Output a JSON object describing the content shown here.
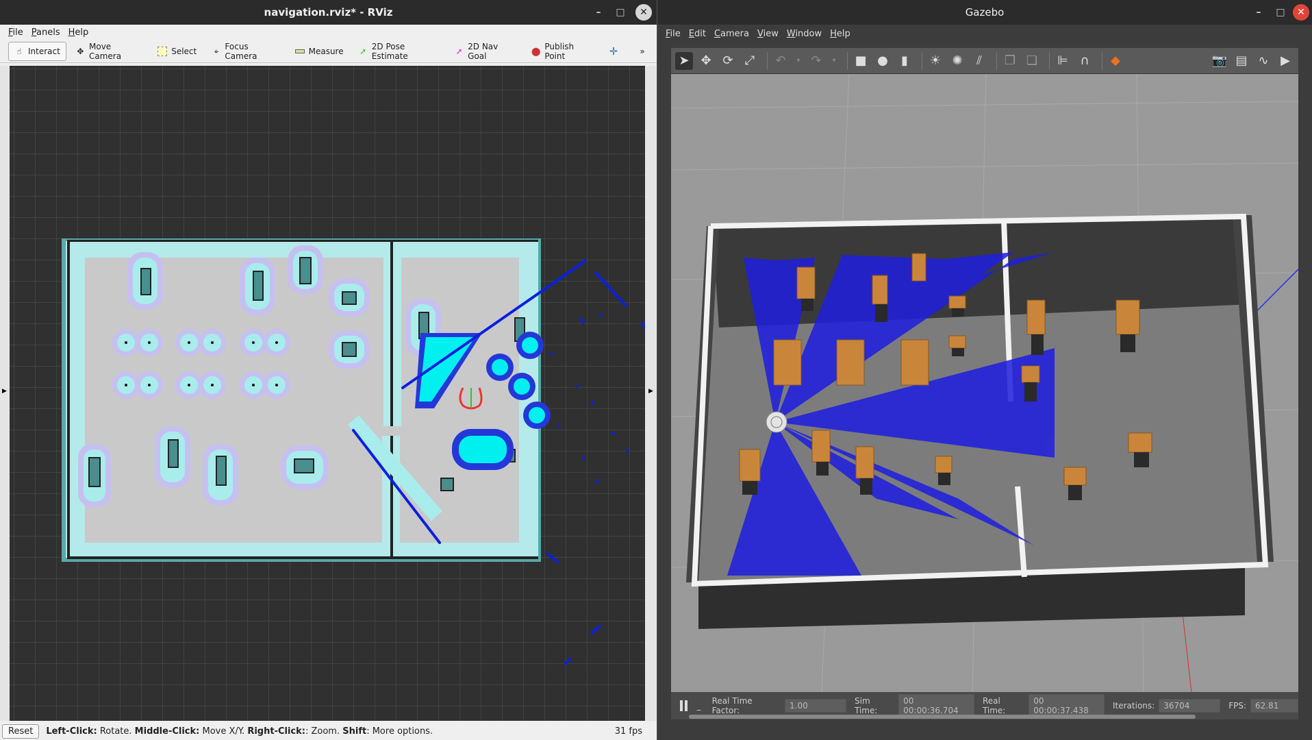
{
  "rviz": {
    "title": "navigation.rviz* - RViz",
    "menu": [
      "File",
      "Panels",
      "Help"
    ],
    "tools": [
      {
        "label": "Interact",
        "icon": "cursor-icon"
      },
      {
        "label": "Move Camera",
        "icon": "move-camera-icon"
      },
      {
        "label": "Select",
        "icon": "select-icon"
      },
      {
        "label": "Focus Camera",
        "icon": "focus-camera-icon"
      },
      {
        "label": "Measure",
        "icon": "measure-icon"
      },
      {
        "label": "2D Pose Estimate",
        "icon": "pose-estimate-icon"
      },
      {
        "label": "2D Nav Goal",
        "icon": "nav-goal-icon"
      },
      {
        "label": "Publish Point",
        "icon": "publish-point-icon"
      }
    ],
    "status": {
      "reset": "Reset",
      "lc": "Left-Click:",
      "lc_t": " Rotate. ",
      "mc": "Middle-Click:",
      "mc_t": " Move X/Y. ",
      "rc": "Right-Click:",
      "rc_t": ": Zoom. ",
      "sh": "Shift",
      "sh_t": ": More options.",
      "fps": "31 fps"
    },
    "colors": {
      "map_bg": "#303030",
      "free": "#c8c8c8",
      "inflation": "#a8e8e8",
      "lethal": "#00ffff",
      "path": "#0a20e0"
    }
  },
  "gazebo": {
    "title": "Gazebo",
    "menu": [
      "File",
      "Edit",
      "Camera",
      "View",
      "Window",
      "Help"
    ],
    "status": {
      "rtf_label": "Real Time Factor:",
      "rtf": "1.00",
      "sim_label": "Sim Time:",
      "sim": "00 00:00:36.704",
      "real_label": "Real Time:",
      "real": "00 00:00:37.438",
      "iter_label": "Iterations:",
      "iter": "36704",
      "fps_label": "FPS:",
      "fps": "62.81"
    }
  }
}
